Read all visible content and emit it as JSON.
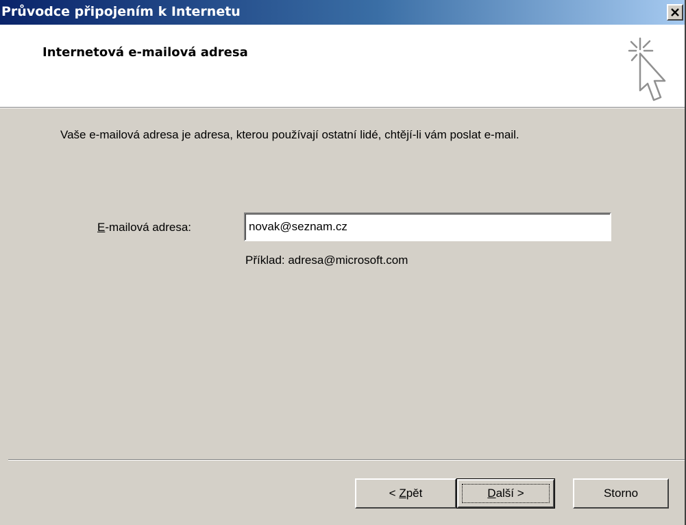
{
  "window": {
    "title": "Průvodce připojením k Internetu",
    "close_glyph": "×"
  },
  "header": {
    "title": "Internetová e-mailová adresa",
    "icon": "wizard-cursor-icon"
  },
  "body": {
    "description": "Vaše e-mailová adresa je adresa, kterou používají ostatní lidé, chtějí-li vám poslat e-mail.",
    "email_label_mnemonic": "E",
    "email_label_rest": "-mailová adresa:",
    "email_value": "novak@seznam.cz",
    "example": "Příklad: adresa@microsoft.com"
  },
  "buttons": {
    "back_prefix": "< ",
    "back_mnemonic": "Z",
    "back_rest": "pět",
    "next_mnemonic": "D",
    "next_rest": "alší >",
    "cancel": "Storno"
  },
  "colors": {
    "titlebar_start": "#0a246a",
    "titlebar_end": "#a6caf0",
    "face": "#d4d0c8",
    "header_bg": "#ffffff"
  }
}
